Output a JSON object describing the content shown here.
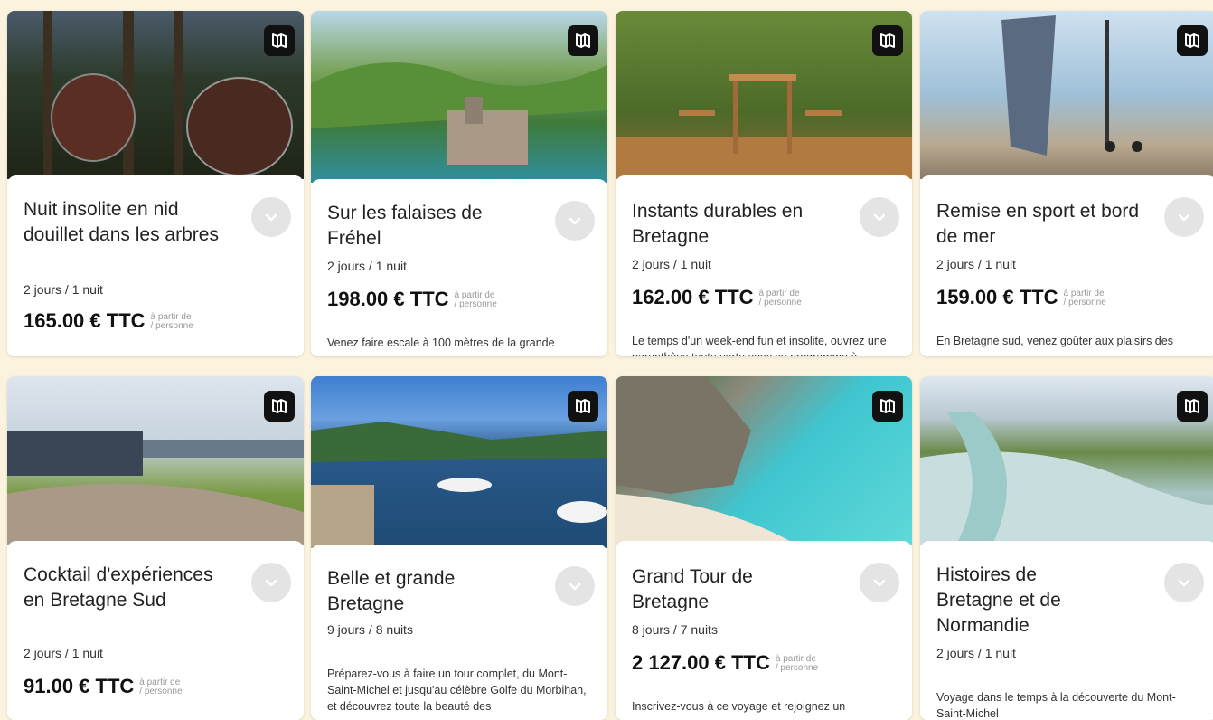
{
  "colors": {
    "background": "#fbf3dd",
    "card": "#ffffff",
    "map_button": "#111111",
    "chevron_button": "#e4e4e4"
  },
  "icons": {
    "map": "map-icon",
    "expand": "chevron-down-icon"
  },
  "price_note": {
    "line1": "à partir de",
    "line2": "/ personne"
  },
  "cards": [
    {
      "title": "Nuit insolite en nid douillet dans les arbres",
      "duration": "2 jours / 1 nuit",
      "price": "165.00 € TTC",
      "description": ""
    },
    {
      "title": "Sur les falaises de Fréhel",
      "duration": "2 jours / 1 nuit",
      "price": "198.00 € TTC",
      "description": "Venez faire escale à 100 mètres de la grande"
    },
    {
      "title": "Instants durables en Bretagne",
      "duration": "2 jours / 1 nuit",
      "price": "162.00 € TTC",
      "description": "Le temps d'un week-end fun et insolite, ouvrez une parenthèse toute verte avec ce programme à"
    },
    {
      "title": "Remise en sport et bord de mer",
      "duration": "2 jours / 1 nuit",
      "price": "159.00 € TTC",
      "description": "En Bretagne sud, venez goûter aux plaisirs des"
    },
    {
      "title": "Cocktail d'expériences en Bretagne Sud",
      "duration": "2 jours / 1 nuit",
      "price": "91.00 € TTC",
      "description": ""
    },
    {
      "title": "Belle et grande Bretagne",
      "duration": "9 jours / 8 nuits",
      "price": "",
      "description": "Préparez-vous à faire un tour complet, du Mont-Saint-Michel et jusqu'au célèbre Golfe du Morbihan, et découvrez toute la beauté des"
    },
    {
      "title": "Grand Tour de Bretagne",
      "duration": "8 jours / 7 nuits",
      "price": "2 127.00 € TTC",
      "description": "Inscrivez-vous à ce voyage et rejoignez un"
    },
    {
      "title": "Histoires de Bretagne et de Normandie",
      "duration": "2 jours / 1 nuit",
      "price": "",
      "description": "Voyage dans le temps à la découverte du Mont-Saint-Michel"
    }
  ]
}
